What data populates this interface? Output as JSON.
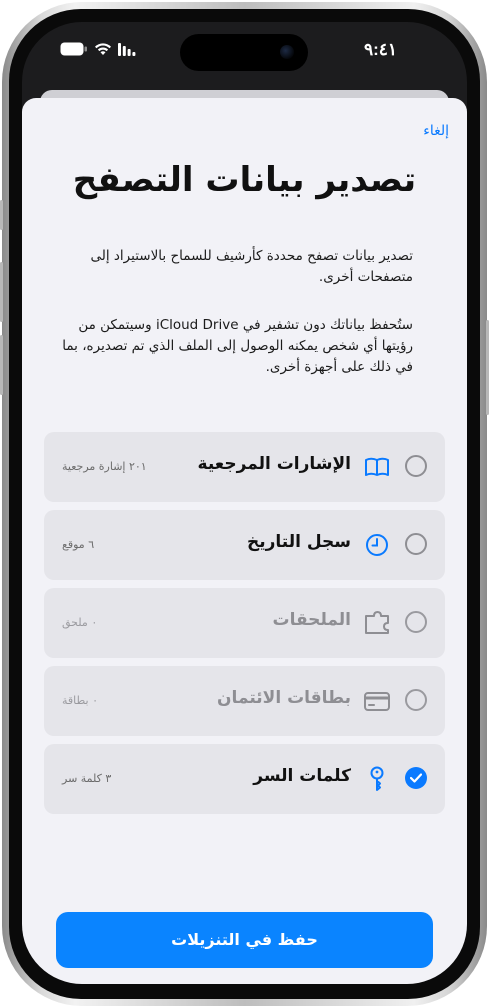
{
  "status_bar": {
    "time": "٩:٤١"
  },
  "sheet": {
    "cancel_label": "إلغاء",
    "title": "تصدير بيانات التصفح",
    "description_1": "تصدير بيانات تصفح محددة كأرشيف للسماح بالاستيراد إلى متصفحات أخرى.",
    "description_2": "ستُحفظ بياناتك دون تشفير في iCloud Drive وسيتمكن من رؤيتها أي شخص يمكنه الوصول إلى الملف الذي تم تصديره، بما في ذلك على أجهزة أخرى."
  },
  "options": [
    {
      "label": "الإشارات المرجعية",
      "count": "٢٠١ إشارة مرجعية",
      "icon": "book-icon",
      "checked": false,
      "enabled": true
    },
    {
      "label": "سجل التاريخ",
      "count": "٦ موقع",
      "icon": "clock-icon",
      "checked": false,
      "enabled": true
    },
    {
      "label": "الملحقات",
      "count": "٠ ملحق",
      "icon": "puzzle-icon",
      "checked": false,
      "enabled": false
    },
    {
      "label": "بطاقات الائتمان",
      "count": "٠ بطاقة",
      "icon": "credit-card-icon",
      "checked": false,
      "enabled": false
    },
    {
      "label": "كلمات السر",
      "count": "٣ كلمة سر",
      "icon": "key-icon",
      "checked": true,
      "enabled": true
    }
  ],
  "save_button_label": "حفظ في التنزيلات",
  "colors": {
    "accent": "#0a84ff",
    "sheet_bg": "#f2f2f7",
    "row_bg": "#e5e5ea"
  }
}
